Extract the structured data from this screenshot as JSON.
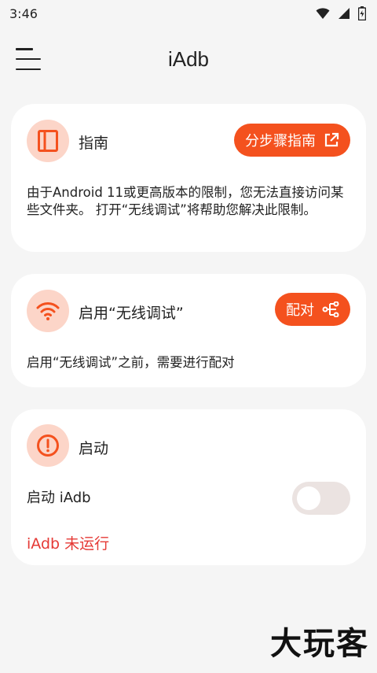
{
  "status_bar": {
    "time": "3:46"
  },
  "app_bar": {
    "title": "iAdb"
  },
  "guide_card": {
    "title": "指南",
    "button_label": "分步骤指南",
    "description": "由于Android 11或更高版本的限制，您无法直接访问某些文件夹。 打开“无线调试”将帮助您解决此限制。"
  },
  "wireless_card": {
    "title": "启用“无线调试”",
    "button_label": "配对",
    "description": "启用“无线调试”之前，需要进行配对"
  },
  "start_card": {
    "title": "启动",
    "toggle_label": "启动 iAdb",
    "toggle_on": false,
    "status": "iAdb 未运行"
  },
  "watermark": "大玩客",
  "colors": {
    "accent": "#f4511e",
    "icon_bg": "#fcd5c8",
    "error": "#e53935",
    "background": "#f5f5f5"
  }
}
